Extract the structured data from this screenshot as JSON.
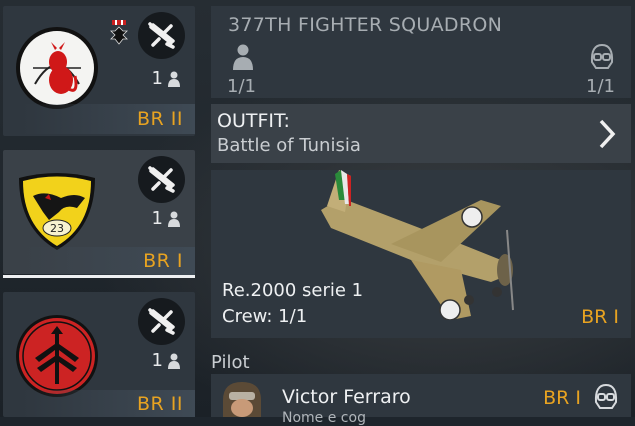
{
  "squadrons": [
    {
      "count": "1",
      "br": "BR II",
      "emblem": "red-devil-archer-emblem",
      "has_medal": true
    },
    {
      "count": "1",
      "br": "BR I",
      "emblem": "yellow-shield-23-emblem",
      "has_medal": false
    },
    {
      "count": "1",
      "br": "BR II",
      "emblem": "red-fasces-emblem",
      "has_medal": false
    }
  ],
  "squadron_panel": {
    "title": "377TH FIGHTER SQUADRON",
    "crew_count": "1/1",
    "pilot_count": "1/1"
  },
  "outfit": {
    "label": "OUTFIT:",
    "value": "Battle of Tunisia"
  },
  "plane": {
    "name": "Re.2000 serie 1",
    "crew": "Crew: 1/1",
    "br": "BR I"
  },
  "pilot": {
    "section_label": "Pilot",
    "name": "Victor Ferraro",
    "subtitle": "Nome e cog",
    "br": "BR I"
  },
  "colors": {
    "accent": "#e8a321",
    "panel": "#2f373f",
    "selected_underline": "#eef0f2"
  }
}
